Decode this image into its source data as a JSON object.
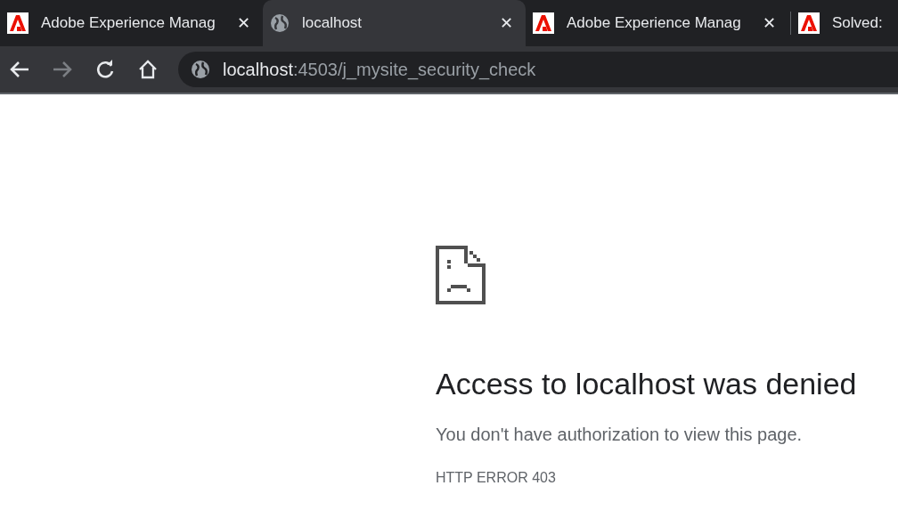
{
  "tabs": [
    {
      "kind": "adobe",
      "title": "Adobe Experience Manag",
      "close": "✕",
      "selected": false
    },
    {
      "kind": "globe",
      "title": "localhost",
      "close": "✕",
      "selected": true
    },
    {
      "kind": "adobe",
      "title": "Adobe Experience Manag",
      "close": "✕",
      "selected": false
    },
    {
      "kind": "adobe",
      "title": "Solved:",
      "selected": false
    }
  ],
  "toolbar": {
    "back_disabled": false,
    "forward_disabled": true,
    "url_host": "localhost",
    "url_path": ":4503/j_mysite_security_check"
  },
  "error": {
    "title": "Access to localhost was denied",
    "message": "You don't have authorization to view this page.",
    "code": "HTTP ERROR 403"
  }
}
